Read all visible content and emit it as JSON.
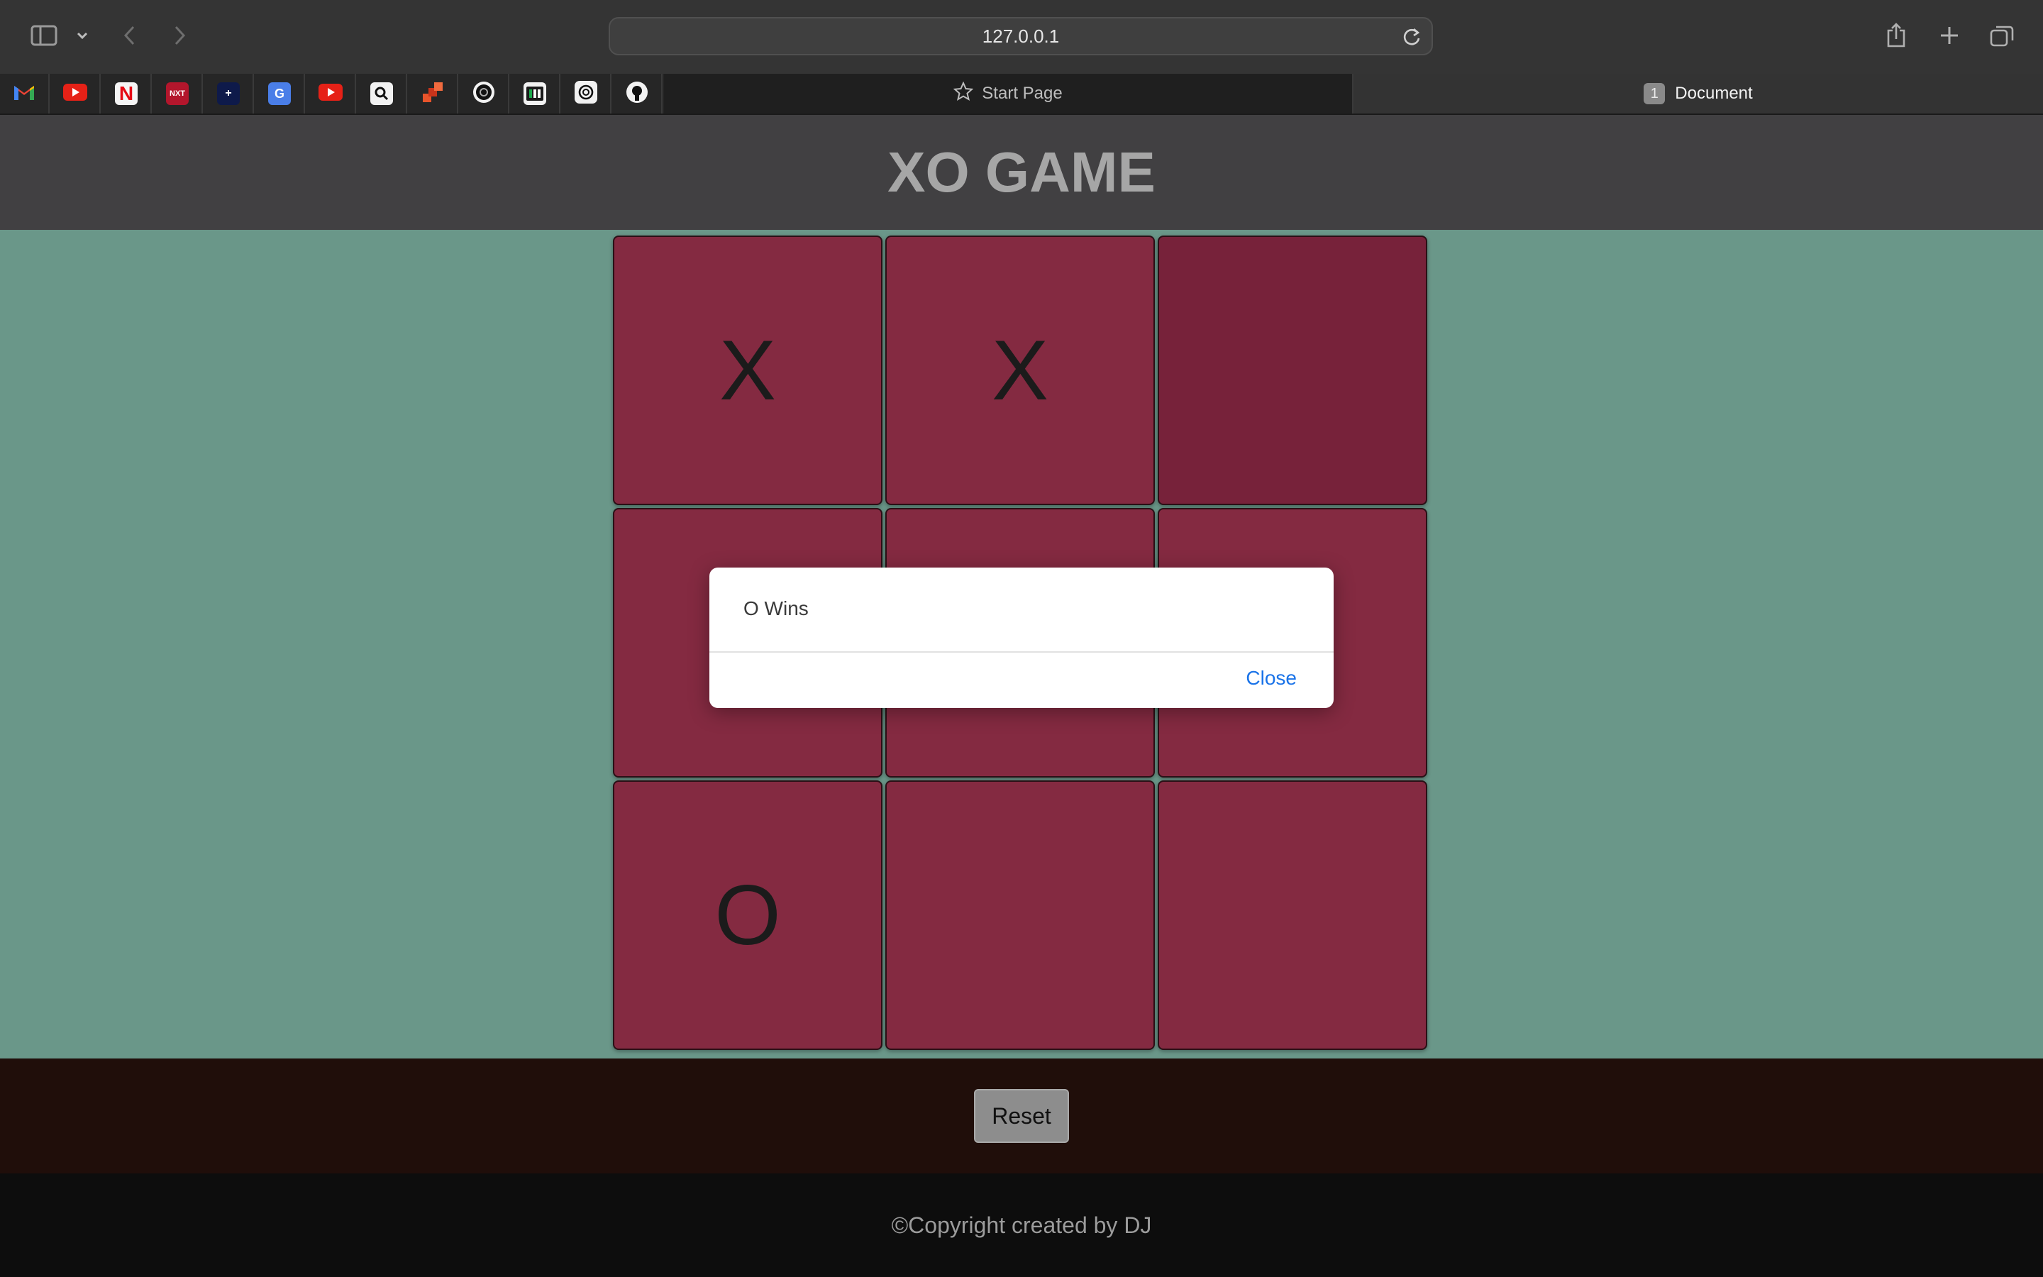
{
  "browser": {
    "url": "127.0.0.1",
    "tabs": [
      {
        "label": "Start Page",
        "active": false
      },
      {
        "label": "Document",
        "active": true,
        "count": "1"
      }
    ],
    "bookmarks": [
      "gmail-icon",
      "youtube-icon",
      "netflix-icon",
      "sunnxt-icon",
      "hotstar-icon",
      "google-translate-icon",
      "youtube-icon",
      "search-app-icon",
      "stack-app-icon",
      "perplexity-icon",
      "hackerrank-icon",
      "chatgpt-icon",
      "github-icon"
    ]
  },
  "page": {
    "title": "XO GAME",
    "board": [
      [
        "X",
        "X",
        ""
      ],
      [
        "",
        "",
        ""
      ],
      [
        "O",
        "",
        ""
      ]
    ],
    "reset_label": "Reset",
    "footer": "©Copyright created by DJ"
  },
  "alert": {
    "message": "O Wins",
    "close_label": "Close"
  },
  "colors": {
    "header_bg": "#414042",
    "game_bg": "#6a9789",
    "cell_bg": "#842a41",
    "controls_bg": "#200e0a",
    "footer_bg": "#0d0d0d",
    "link_blue": "#1a73e8"
  }
}
